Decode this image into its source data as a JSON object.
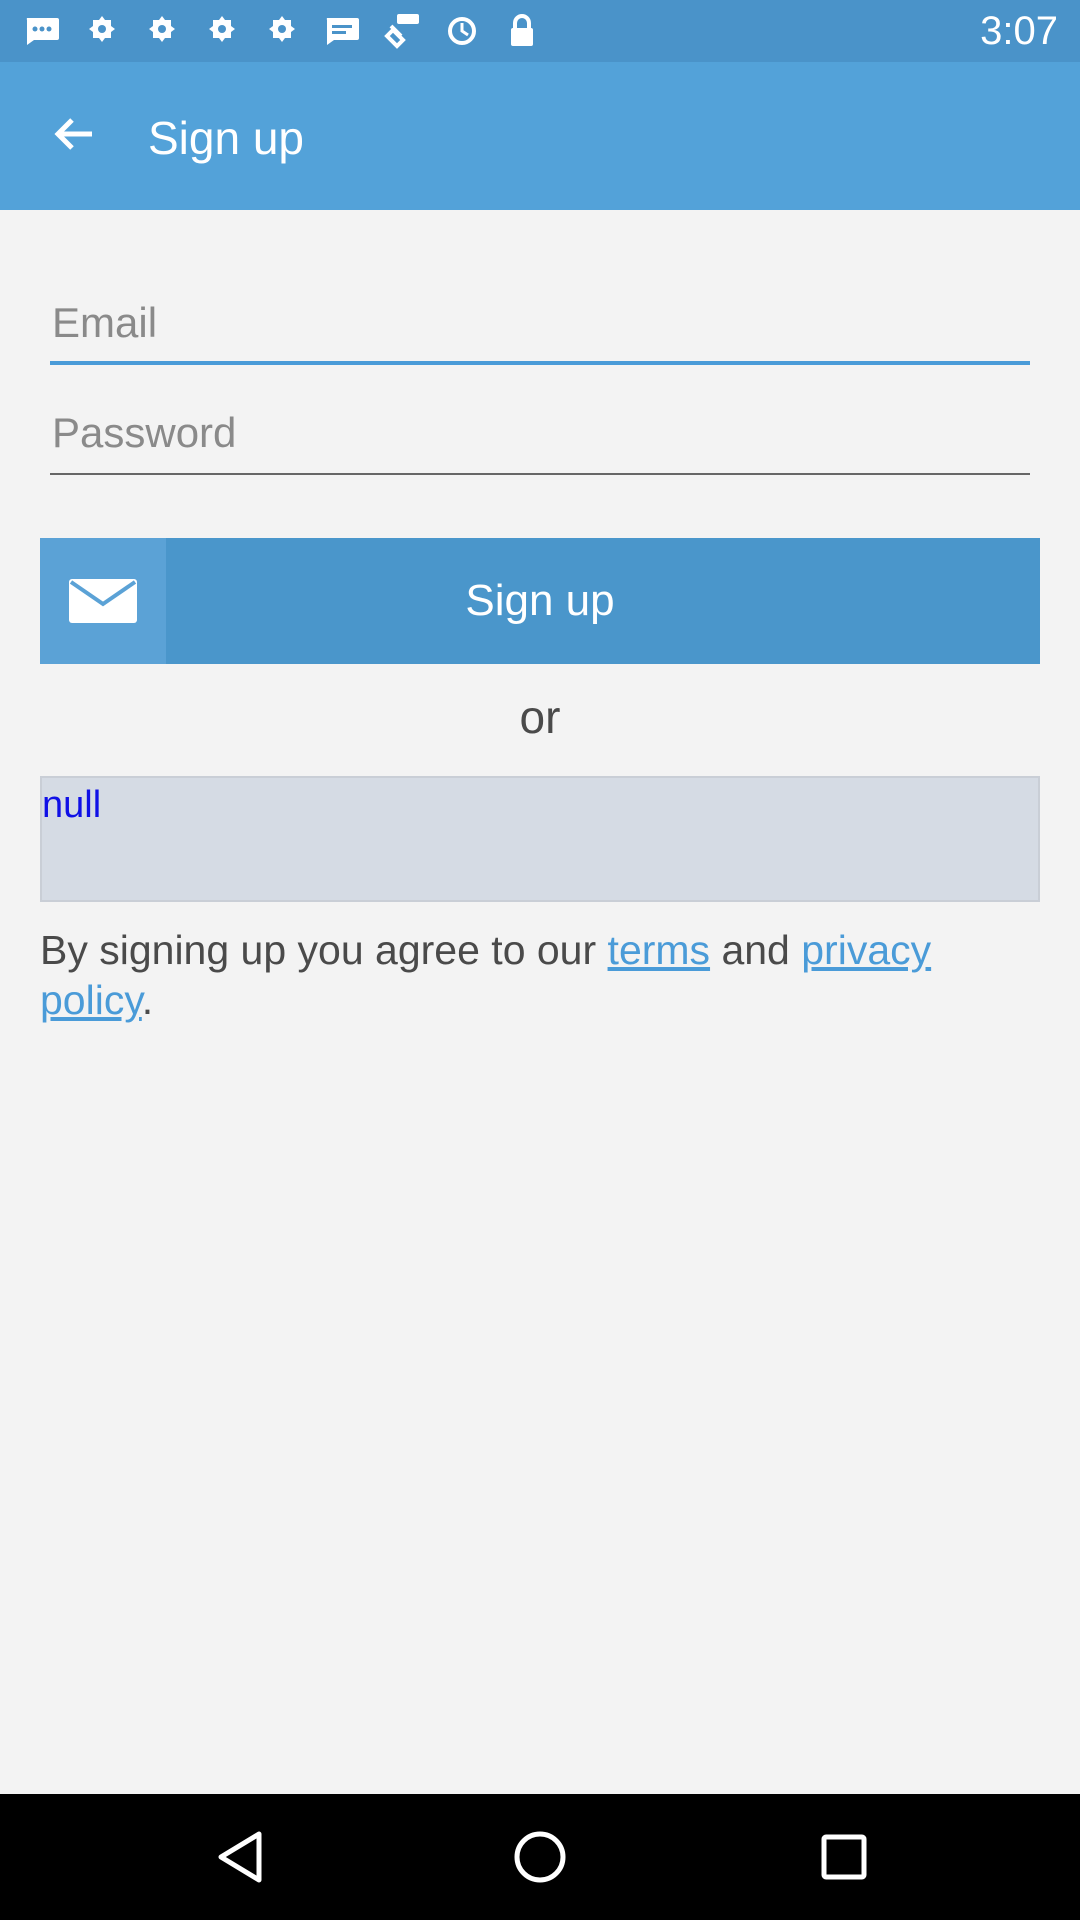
{
  "status_bar": {
    "time": "3:07",
    "icons": [
      "message-icon",
      "gear-icon",
      "gear-icon",
      "gear-icon",
      "gear-icon",
      "message-icon",
      "fake-gps-icon",
      "sync-icon",
      "lock-icon"
    ]
  },
  "app_bar": {
    "title": "Sign up",
    "back_icon": "arrow-left-icon"
  },
  "form": {
    "email_placeholder": "Email",
    "password_placeholder": "Password",
    "signup_label": "Sign up",
    "or_label": "or",
    "null_label": "null"
  },
  "terms": {
    "prefix": "By signing up you agree to our ",
    "terms_link": "terms",
    "middle": " and ",
    "privacy_link": "privacy policy",
    "suffix": "."
  },
  "colors": {
    "status_bar": "#4a93c9",
    "app_bar": "#53a2d9",
    "accent": "#4a9bd8",
    "button": "#4a96cb",
    "null_box": "#d5dbe4",
    "null_text": "#1010e6"
  },
  "nav_bar": {
    "icons": [
      "back-triangle-icon",
      "home-circle-icon",
      "recents-square-icon"
    ]
  }
}
